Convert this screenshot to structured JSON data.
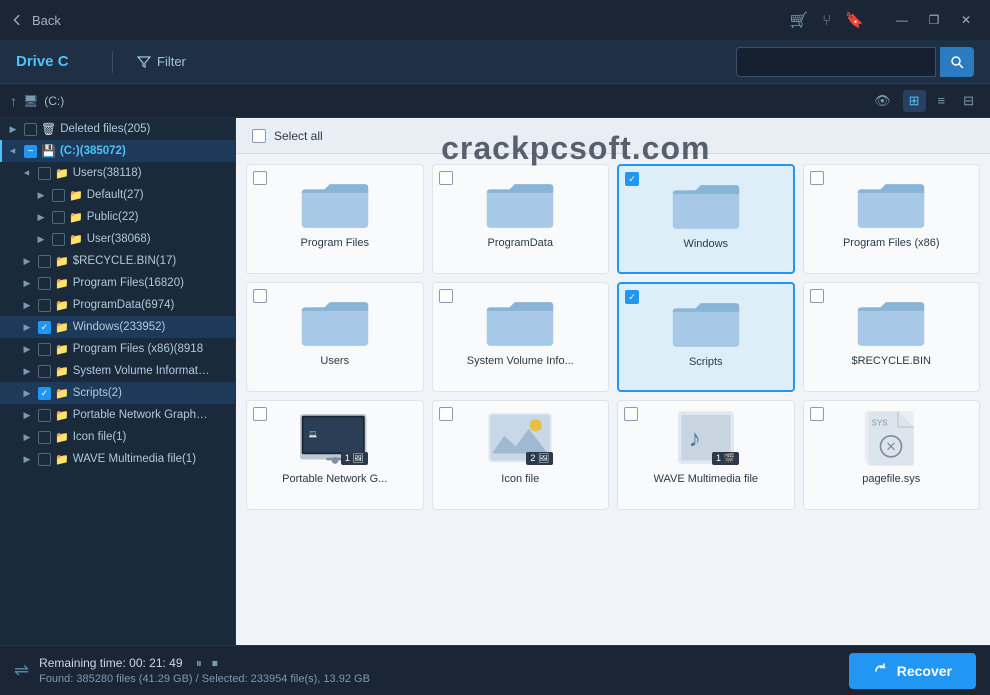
{
  "titlebar": {
    "back_label": "Back",
    "icons": [
      "cart-icon",
      "share-icon",
      "bookmark-icon",
      "layout-icon",
      "minimize-icon",
      "maximize-icon",
      "close-icon"
    ]
  },
  "toolbar": {
    "drive_label": "Drive C",
    "filter_label": "Filter",
    "search_placeholder": ""
  },
  "pathbar": {
    "path": "(C:)"
  },
  "watermark": "crackpcsoft.com",
  "sidebar": {
    "items": [
      {
        "id": "deleted",
        "label": "Deleted files(205)",
        "indent": 0,
        "expanded": false,
        "checked": false,
        "partial": false,
        "type": "trash"
      },
      {
        "id": "drive_c",
        "label": "(C:)(385072)",
        "indent": 0,
        "expanded": true,
        "checked": false,
        "partial": true,
        "type": "drive"
      },
      {
        "id": "users_root",
        "label": "Users(38118)",
        "indent": 1,
        "expanded": true,
        "checked": false,
        "partial": false,
        "type": "folder"
      },
      {
        "id": "default",
        "label": "Default(27)",
        "indent": 2,
        "expanded": false,
        "checked": false,
        "partial": false,
        "type": "folder"
      },
      {
        "id": "public",
        "label": "Public(22)",
        "indent": 2,
        "expanded": false,
        "checked": false,
        "partial": false,
        "type": "folder"
      },
      {
        "id": "user",
        "label": "User(38068)",
        "indent": 2,
        "expanded": false,
        "checked": false,
        "partial": false,
        "type": "folder"
      },
      {
        "id": "recycle",
        "label": "$RECYCLE.BIN(17)",
        "indent": 1,
        "expanded": false,
        "checked": false,
        "partial": false,
        "type": "folder"
      },
      {
        "id": "program_files",
        "label": "Program Files(16820)",
        "indent": 1,
        "expanded": false,
        "checked": false,
        "partial": false,
        "type": "folder"
      },
      {
        "id": "program_data",
        "label": "ProgramData(6974)",
        "indent": 1,
        "expanded": false,
        "checked": false,
        "partial": false,
        "type": "folder"
      },
      {
        "id": "windows",
        "label": "Windows(233952)",
        "indent": 1,
        "expanded": false,
        "checked": true,
        "partial": false,
        "type": "folder"
      },
      {
        "id": "program_files_x86",
        "label": "Program Files (x86)(8918",
        "indent": 1,
        "expanded": false,
        "checked": false,
        "partial": false,
        "type": "folder"
      },
      {
        "id": "system_volume",
        "label": "System Volume Informat…",
        "indent": 1,
        "expanded": false,
        "checked": false,
        "partial": false,
        "type": "folder"
      },
      {
        "id": "scripts",
        "label": "Scripts(2)",
        "indent": 1,
        "expanded": false,
        "checked": true,
        "partial": false,
        "type": "folder"
      },
      {
        "id": "png",
        "label": "Portable Network Graph…",
        "indent": 1,
        "expanded": false,
        "checked": false,
        "partial": false,
        "type": "folder"
      },
      {
        "id": "icon_file",
        "label": "Icon file(1)",
        "indent": 1,
        "expanded": false,
        "checked": false,
        "partial": false,
        "type": "folder"
      },
      {
        "id": "wave",
        "label": "WAVE Multimedia file(1)",
        "indent": 1,
        "expanded": false,
        "checked": false,
        "partial": false,
        "type": "folder"
      }
    ]
  },
  "content": {
    "select_all": "Select all",
    "grid_items": [
      {
        "id": "program_files",
        "label": "Program Files",
        "type": "folder",
        "checked": false,
        "selected": false
      },
      {
        "id": "program_data",
        "label": "ProgramData",
        "type": "folder",
        "checked": false,
        "selected": false
      },
      {
        "id": "windows",
        "label": "Windows",
        "type": "folder",
        "checked": true,
        "selected": true
      },
      {
        "id": "program_files_x86",
        "label": "Program Files (x86)",
        "type": "folder",
        "checked": false,
        "selected": false
      },
      {
        "id": "users",
        "label": "Users",
        "type": "folder",
        "checked": false,
        "selected": false
      },
      {
        "id": "system_volume",
        "label": "System Volume Info...",
        "type": "folder",
        "checked": false,
        "selected": false
      },
      {
        "id": "scripts",
        "label": "Scripts",
        "type": "folder",
        "checked": true,
        "selected": true
      },
      {
        "id": "recycle_bin",
        "label": "$RECYCLE.BIN",
        "type": "folder",
        "checked": false,
        "selected": false
      },
      {
        "id": "png_files",
        "label": "Portable Network G...",
        "type": "image_group",
        "checked": false,
        "selected": false,
        "badge": "1",
        "badge_icon": "image"
      },
      {
        "id": "icon_file",
        "label": "Icon file",
        "type": "image_group2",
        "checked": false,
        "selected": false,
        "badge": "2",
        "badge_icon": "image"
      },
      {
        "id": "wave_file",
        "label": "WAVE Multimedia file",
        "type": "audio",
        "checked": false,
        "selected": false,
        "badge": "1",
        "badge_icon": "film"
      },
      {
        "id": "pagefile",
        "label": "pagefile.sys",
        "type": "sys_file",
        "checked": false,
        "selected": false
      }
    ]
  },
  "statusbar": {
    "remaining_label": "Remaining time:",
    "remaining_time": "00: 21: 49",
    "pause_label": "⏸",
    "stop_label": "⏹",
    "found_label": "Found: 385280 files (41.29 GB) / Selected: 233954 file(s), 13.92 GB",
    "recover_label": "Recover"
  }
}
